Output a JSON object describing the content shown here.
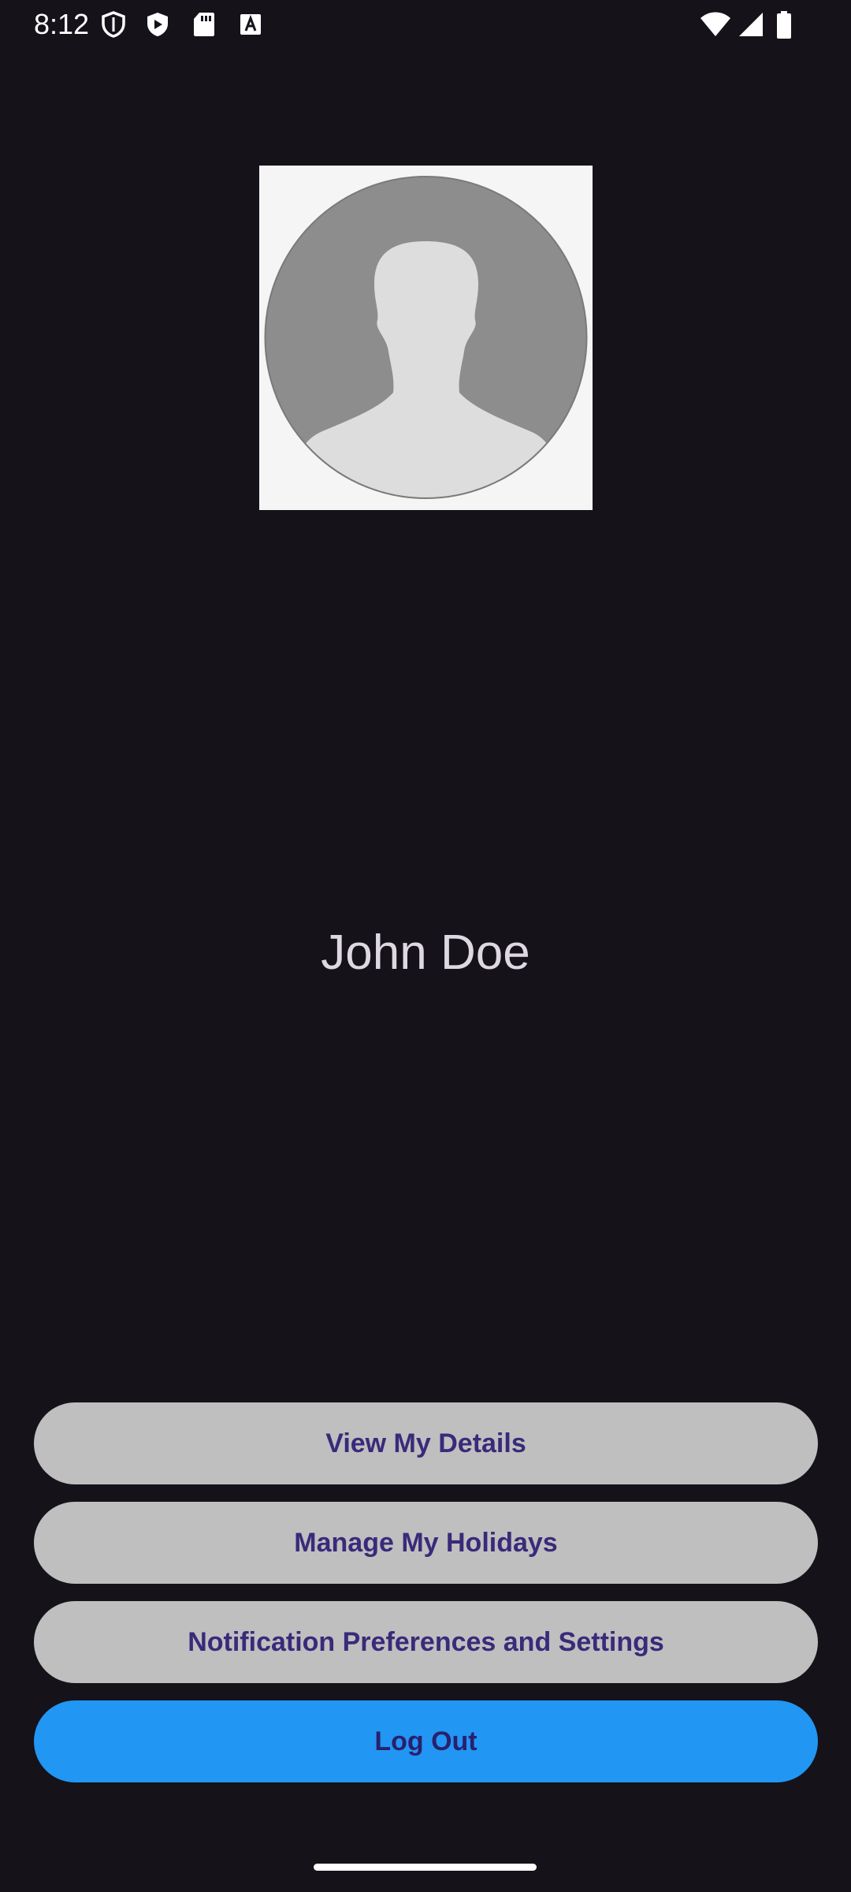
{
  "status_bar": {
    "time": "8:12",
    "left_icons": [
      "shield-icon",
      "play-protect-icon",
      "sd-card-icon",
      "keyboard-a-icon"
    ],
    "right_icons": [
      "wifi-icon",
      "signal-icon",
      "battery-icon"
    ]
  },
  "profile": {
    "avatar": "default-avatar-placeholder",
    "name": "John Doe"
  },
  "actions": {
    "view_details": "View My Details",
    "manage_holidays": "Manage My Holidays",
    "notification_settings": "Notification Preferences and Settings",
    "log_out": "Log Out"
  },
  "colors": {
    "background": "#15121a",
    "secondary_button": "#bfbfbf",
    "primary_button": "#2196f3",
    "button_text": "#3a2a7a",
    "name_text": "#ded8e1"
  }
}
